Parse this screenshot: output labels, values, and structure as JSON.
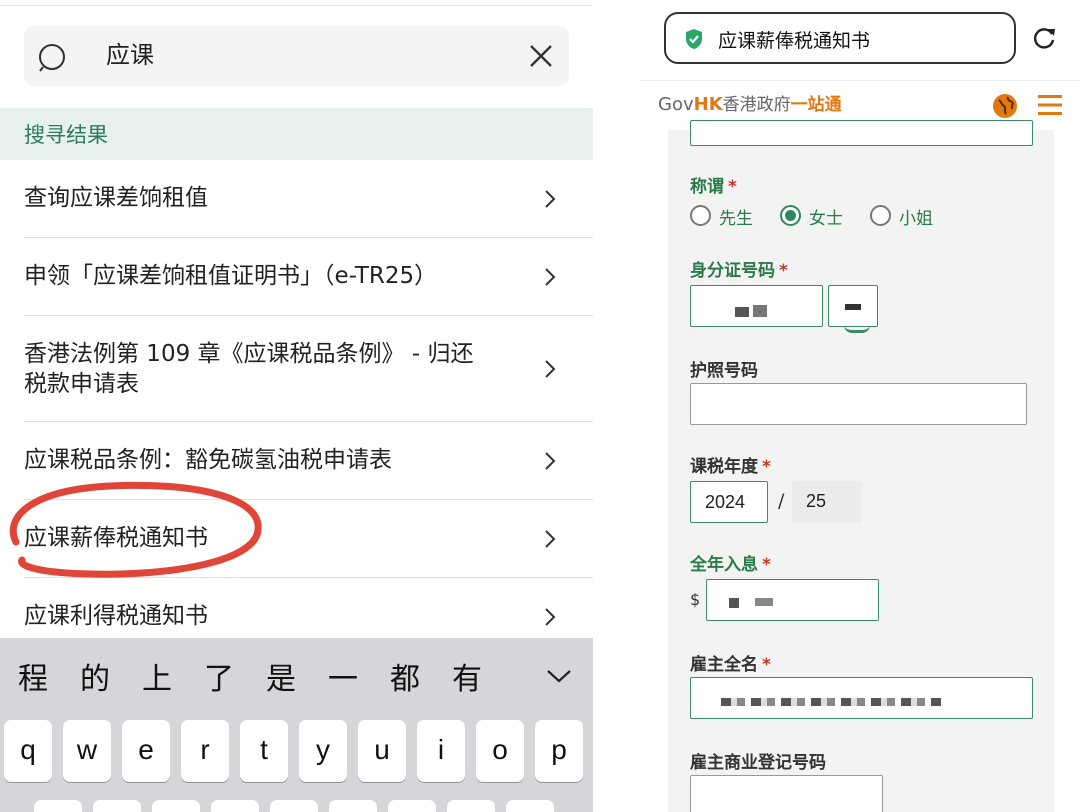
{
  "search": {
    "query": "应课",
    "results_header": "搜寻结果"
  },
  "results": [
    {
      "label": "查询应课差饷租值"
    },
    {
      "label": "申领「应课差饷租值证明书」（e-TR25）"
    },
    {
      "label": "香港法例第 109 章《应课税品条例》 - 归还",
      "label2": "税款申请表"
    },
    {
      "label": "应课税品条例：豁免碳氢油税申请表"
    },
    {
      "label": "应课薪俸税通知书"
    },
    {
      "label": "应课利得税通知书"
    }
  ],
  "keyboard": {
    "candidates": [
      "程",
      "的",
      "上",
      "了",
      "是",
      "一",
      "都",
      "有"
    ],
    "keys": [
      "q",
      "w",
      "e",
      "r",
      "t",
      "y",
      "u",
      "i",
      "o",
      "p"
    ]
  },
  "browser": {
    "url_title": "应课薪俸税通知书"
  },
  "site": {
    "logo_gov": "Gov",
    "logo_hk": "HK",
    "logo_cn": "香港政府",
    "logo_one": "一站通"
  },
  "form": {
    "title_label": "称谓",
    "title_options": [
      "先生",
      "女士",
      "小姐"
    ],
    "title_selected": "女士",
    "id_label": "身分证号码",
    "passport_label": "护照号码",
    "year_label": "课税年度",
    "year_start": "2024",
    "year_sep": "/",
    "year_end": "25",
    "income_label": "全年入息",
    "currency": "$",
    "employer_label": "雇主全名",
    "br_label": "雇主商业登记号码",
    "required_mark": "*"
  },
  "colors": {
    "accent_green": "#2b7a4a",
    "orange": "#e07a10",
    "annotation_red": "#e0453a"
  }
}
